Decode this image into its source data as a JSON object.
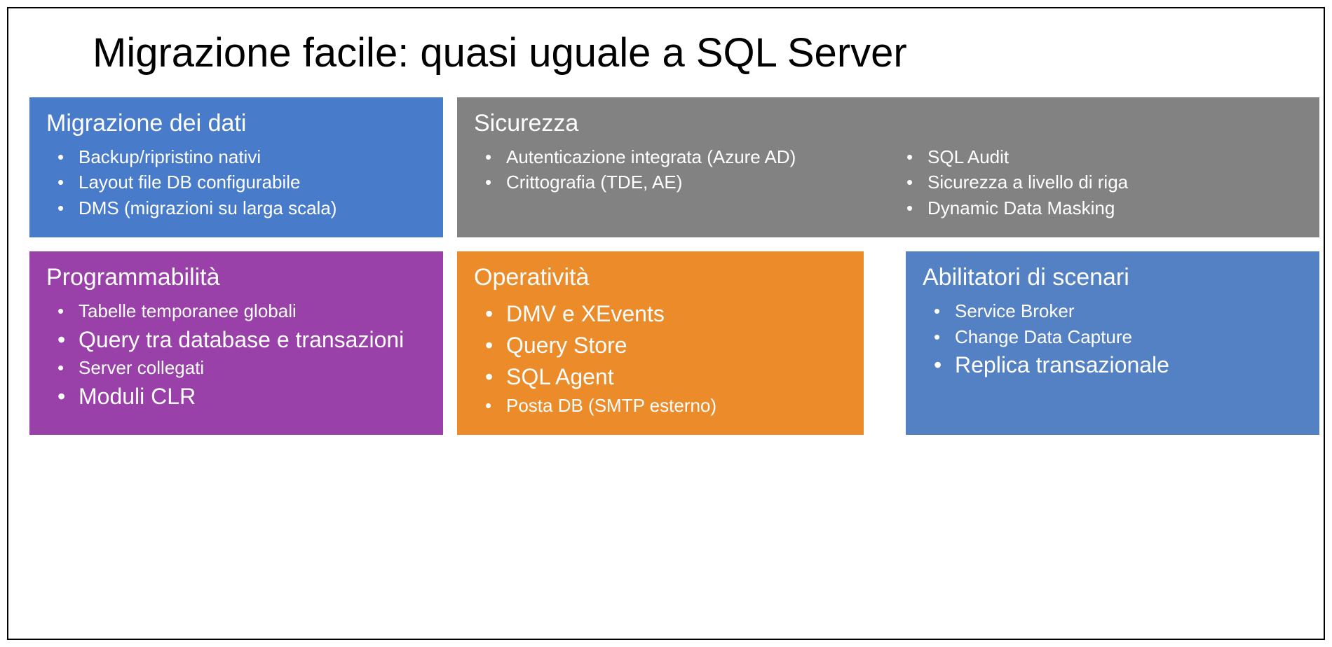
{
  "title": "Migrazione facile: quasi uguale a SQL Server",
  "panels": {
    "dataMigration": {
      "heading": "Migrazione dei dati",
      "items": [
        "Backup/ripristino nativi",
        "Layout file DB configurabile",
        "DMS (migrazioni su larga scala)"
      ]
    },
    "security": {
      "heading": "Sicurezza",
      "colA": [
        "Autenticazione integrata (Azure AD)",
        "Crittografia (TDE, AE)"
      ],
      "colB": [
        "SQL Audit",
        "Sicurezza a livello di riga",
        "Dynamic Data Masking"
      ]
    },
    "programmability": {
      "heading": "Programmabilità",
      "items": [
        "Tabelle temporanee globali",
        "Query tra database e transazioni",
        "Server collegati",
        "Moduli CLR"
      ]
    },
    "operational": {
      "heading": "Operatività",
      "items": [
        "DMV e  XEvents",
        "Query Store",
        "SQL Agent",
        "Posta DB (SMTP esterno)"
      ]
    },
    "scenario": {
      "heading": "Abilitatori di scenari",
      "items": [
        "Service Broker",
        "Change Data Capture",
        "Replica transazionale"
      ]
    }
  },
  "colors": {
    "blue": "#487bc9",
    "gray": "#828282",
    "purple": "#9940a9",
    "orange": "#eb8b29",
    "blue2": "#5481c4"
  }
}
